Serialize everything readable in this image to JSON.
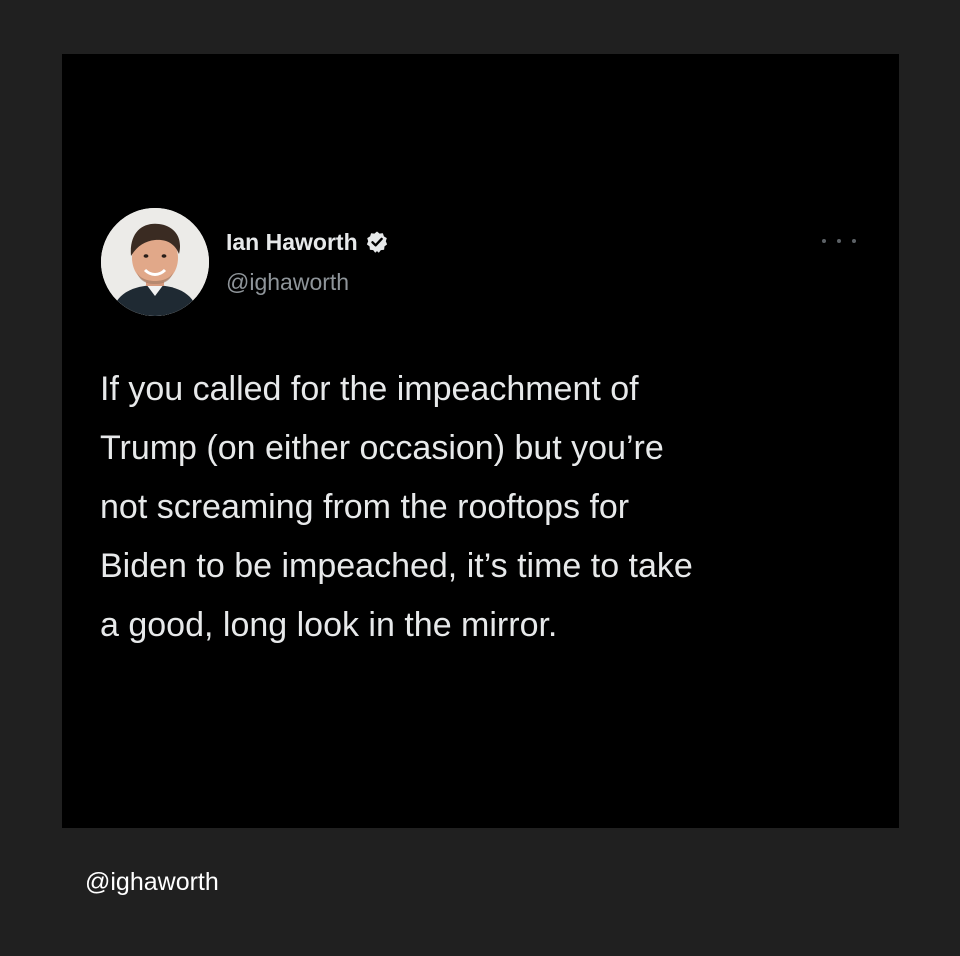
{
  "tweet": {
    "display_name": "Ian Haworth",
    "handle": "@ighaworth",
    "verified": true,
    "more_icon": "more-horizontal-icon",
    "text": "If you called for the impeachment of\nTrump (on either occasion) but you’re\nnot screaming from the rooftops for\nBiden to be impeached, it’s time to take\na good, long look in the mirror."
  },
  "footer": {
    "handle": "@ighaworth"
  },
  "colors": {
    "page_background": "#202020",
    "card_background": "#000000",
    "primary_text": "#e7e9ea",
    "secondary_text": "#8f959a"
  }
}
